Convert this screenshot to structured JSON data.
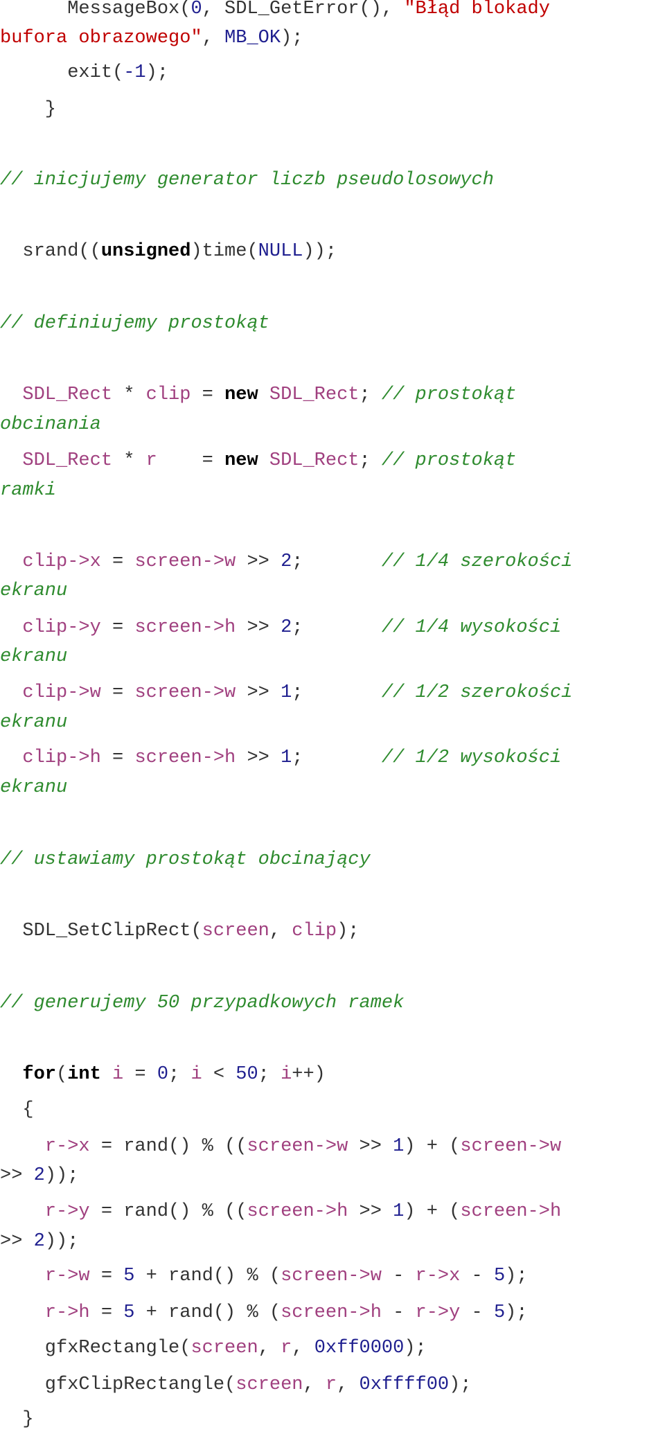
{
  "colors": {
    "plain": "#333333",
    "string": "#c00000",
    "number": "#1f1f8f",
    "identifier": "#a0407f",
    "keyword": "#000000",
    "comment": "#2e8b2e"
  },
  "lines": [
    {
      "tokens": [
        [
          "plain",
          "      MessageBox("
        ],
        [
          "num",
          "0"
        ],
        [
          "plain",
          ", SDL_GetError(), "
        ],
        [
          "str",
          "\"Błąd blokady"
        ]
      ]
    },
    {
      "tokens": [
        [
          "str",
          "bufora obrazowego\""
        ],
        [
          "plain",
          ", "
        ],
        [
          "num",
          "MB_OK"
        ],
        [
          "plain",
          ");"
        ]
      ]
    },
    {
      "tokens": [
        [
          "plain",
          "      exit("
        ],
        [
          "num",
          "-1"
        ],
        [
          "plain",
          ");"
        ]
      ]
    },
    {
      "tokens": [
        [
          "plain",
          "    }"
        ]
      ]
    },
    {
      "tokens": [
        [
          "com",
          "// inicjujemy generator liczb pseudolosowych"
        ]
      ]
    },
    {
      "tokens": [
        [
          "plain",
          "  srand(("
        ],
        [
          "kw",
          "unsigned"
        ],
        [
          "plain",
          ")time("
        ],
        [
          "num",
          "NULL"
        ],
        [
          "plain",
          "));"
        ]
      ]
    },
    {
      "tokens": [
        [
          "com",
          "// definiujemy prostokąt"
        ]
      ]
    },
    {
      "tokens": [
        [
          "plain",
          "  "
        ],
        [
          "var",
          "SDL_Rect"
        ],
        [
          "plain",
          " * "
        ],
        [
          "var",
          "clip"
        ],
        [
          "plain",
          " = "
        ],
        [
          "kw",
          "new"
        ],
        [
          "plain",
          " "
        ],
        [
          "var",
          "SDL_Rect"
        ],
        [
          "plain",
          "; "
        ],
        [
          "com",
          "// prostokąt"
        ]
      ]
    },
    {
      "tokens": [
        [
          "com",
          "obcinania"
        ]
      ]
    },
    {
      "tokens": [
        [
          "plain",
          "  "
        ],
        [
          "var",
          "SDL_Rect"
        ],
        [
          "plain",
          " * "
        ],
        [
          "var",
          "r"
        ],
        [
          "plain",
          "    = "
        ],
        [
          "kw",
          "new"
        ],
        [
          "plain",
          " "
        ],
        [
          "var",
          "SDL_Rect"
        ],
        [
          "plain",
          "; "
        ],
        [
          "com",
          "// prostokąt"
        ]
      ]
    },
    {
      "tokens": [
        [
          "com",
          "ramki"
        ]
      ]
    },
    {
      "tokens": [
        [
          "plain",
          "  "
        ],
        [
          "var",
          "clip->x"
        ],
        [
          "plain",
          " = "
        ],
        [
          "var",
          "screen->w"
        ],
        [
          "plain",
          " >> "
        ],
        [
          "num",
          "2"
        ],
        [
          "plain",
          ";       "
        ],
        [
          "com",
          "// 1/4 szerokości"
        ]
      ]
    },
    {
      "tokens": [
        [
          "com",
          "ekranu"
        ]
      ]
    },
    {
      "tokens": [
        [
          "plain",
          "  "
        ],
        [
          "var",
          "clip->y"
        ],
        [
          "plain",
          " = "
        ],
        [
          "var",
          "screen->h"
        ],
        [
          "plain",
          " >> "
        ],
        [
          "num",
          "2"
        ],
        [
          "plain",
          ";       "
        ],
        [
          "com",
          "// 1/4 wysokości"
        ]
      ]
    },
    {
      "tokens": [
        [
          "com",
          "ekranu"
        ]
      ]
    },
    {
      "tokens": [
        [
          "plain",
          "  "
        ],
        [
          "var",
          "clip->w"
        ],
        [
          "plain",
          " = "
        ],
        [
          "var",
          "screen->w"
        ],
        [
          "plain",
          " >> "
        ],
        [
          "num",
          "1"
        ],
        [
          "plain",
          ";       "
        ],
        [
          "com",
          "// 1/2 szerokości"
        ]
      ]
    },
    {
      "tokens": [
        [
          "com",
          "ekranu"
        ]
      ]
    },
    {
      "tokens": [
        [
          "plain",
          "  "
        ],
        [
          "var",
          "clip->h"
        ],
        [
          "plain",
          " = "
        ],
        [
          "var",
          "screen->h"
        ],
        [
          "plain",
          " >> "
        ],
        [
          "num",
          "1"
        ],
        [
          "plain",
          ";       "
        ],
        [
          "com",
          "// 1/2 wysokości"
        ]
      ]
    },
    {
      "tokens": [
        [
          "com",
          "ekranu"
        ]
      ]
    },
    {
      "tokens": [
        [
          "com",
          "// ustawiamy prostokąt obcinający"
        ]
      ]
    },
    {
      "tokens": [
        [
          "plain",
          "  SDL_SetClipRect("
        ],
        [
          "var",
          "screen"
        ],
        [
          "plain",
          ", "
        ],
        [
          "var",
          "clip"
        ],
        [
          "plain",
          ");"
        ]
      ]
    },
    {
      "tokens": [
        [
          "com",
          "// generujemy 50 przypadkowych ramek"
        ]
      ]
    },
    {
      "tokens": [
        [
          "plain",
          "  "
        ],
        [
          "kw",
          "for"
        ],
        [
          "plain",
          "("
        ],
        [
          "kw",
          "int"
        ],
        [
          "plain",
          " "
        ],
        [
          "var",
          "i"
        ],
        [
          "plain",
          " = "
        ],
        [
          "num",
          "0"
        ],
        [
          "plain",
          "; "
        ],
        [
          "var",
          "i"
        ],
        [
          "plain",
          " < "
        ],
        [
          "num",
          "50"
        ],
        [
          "plain",
          "; "
        ],
        [
          "var",
          "i"
        ],
        [
          "plain",
          "++)"
        ]
      ]
    },
    {
      "tokens": [
        [
          "plain",
          "  {"
        ]
      ]
    },
    {
      "tokens": [
        [
          "plain",
          "    "
        ],
        [
          "var",
          "r->x"
        ],
        [
          "plain",
          " = rand() % (("
        ],
        [
          "var",
          "screen->w"
        ],
        [
          "plain",
          " >> "
        ],
        [
          "num",
          "1"
        ],
        [
          "plain",
          ") + ("
        ],
        [
          "var",
          "screen->w"
        ]
      ]
    },
    {
      "tokens": [
        [
          "plain",
          ">> "
        ],
        [
          "num",
          "2"
        ],
        [
          "plain",
          "));"
        ]
      ]
    },
    {
      "tokens": [
        [
          "plain",
          "    "
        ],
        [
          "var",
          "r->y"
        ],
        [
          "plain",
          " = rand() % (("
        ],
        [
          "var",
          "screen->h"
        ],
        [
          "plain",
          " >> "
        ],
        [
          "num",
          "1"
        ],
        [
          "plain",
          ") + ("
        ],
        [
          "var",
          "screen->h"
        ]
      ]
    },
    {
      "tokens": [
        [
          "plain",
          ">> "
        ],
        [
          "num",
          "2"
        ],
        [
          "plain",
          "));"
        ]
      ]
    },
    {
      "tokens": [
        [
          "plain",
          "    "
        ],
        [
          "var",
          "r->w"
        ],
        [
          "plain",
          " = "
        ],
        [
          "num",
          "5"
        ],
        [
          "plain",
          " + rand() % ("
        ],
        [
          "var",
          "screen->w"
        ],
        [
          "plain",
          " - "
        ],
        [
          "var",
          "r->x"
        ],
        [
          "plain",
          " - "
        ],
        [
          "num",
          "5"
        ],
        [
          "plain",
          ");"
        ]
      ]
    },
    {
      "tokens": [
        [
          "plain",
          "    "
        ],
        [
          "var",
          "r->h"
        ],
        [
          "plain",
          " = "
        ],
        [
          "num",
          "5"
        ],
        [
          "plain",
          " + rand() % ("
        ],
        [
          "var",
          "screen->h"
        ],
        [
          "plain",
          " - "
        ],
        [
          "var",
          "r->y"
        ],
        [
          "plain",
          " - "
        ],
        [
          "num",
          "5"
        ],
        [
          "plain",
          ");"
        ]
      ]
    },
    {
      "tokens": [
        [
          "plain",
          "    gfxRectangle("
        ],
        [
          "var",
          "screen"
        ],
        [
          "plain",
          ", "
        ],
        [
          "var",
          "r"
        ],
        [
          "plain",
          ", "
        ],
        [
          "num",
          "0xff0000"
        ],
        [
          "plain",
          ");"
        ]
      ]
    },
    {
      "tokens": [
        [
          "plain",
          "    gfxClipRectangle("
        ],
        [
          "var",
          "screen"
        ],
        [
          "plain",
          ", "
        ],
        [
          "var",
          "r"
        ],
        [
          "plain",
          ", "
        ],
        [
          "num",
          "0xffff00"
        ],
        [
          "plain",
          ");"
        ]
      ]
    },
    {
      "tokens": [
        [
          "plain",
          "  }"
        ]
      ]
    }
  ]
}
